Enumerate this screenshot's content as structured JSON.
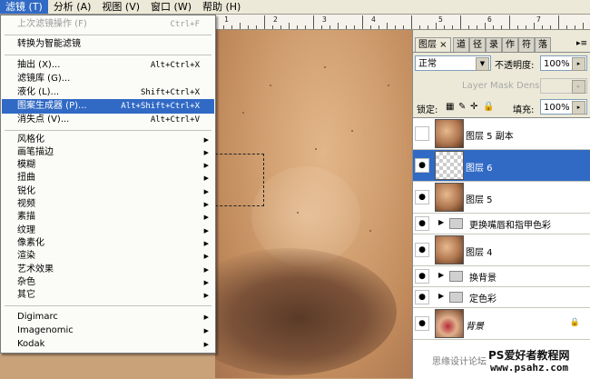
{
  "menubar": {
    "items": [
      {
        "label": "滤镜 (T)"
      },
      {
        "label": "分析 (A)"
      },
      {
        "label": "视图 (V)"
      },
      {
        "label": "窗口 (W)"
      },
      {
        "label": "帮助 (H)"
      }
    ]
  },
  "ruler": {
    "labels": [
      "1",
      "2",
      "3",
      "4",
      "5",
      "6",
      "7"
    ]
  },
  "filter_menu": {
    "last_filter": {
      "label": "上次滤镜操作 (F)",
      "shortcut": "Ctrl+F"
    },
    "smart_filter": {
      "label": "转换为智能滤镜"
    },
    "extract": {
      "label": "抽出 (X)...",
      "shortcut": "Alt+Ctrl+X"
    },
    "gallery": {
      "label": "滤镜库 (G)..."
    },
    "liquify": {
      "label": "液化 (L)...",
      "shortcut": "Shift+Ctrl+X"
    },
    "pattern_maker": {
      "label": "图案生成器 (P)...",
      "shortcut": "Alt+Shift+Ctrl+X"
    },
    "vanishing_point": {
      "label": "消失点 (V)...",
      "shortcut": "Alt+Ctrl+V"
    },
    "groups": [
      {
        "label": "风格化"
      },
      {
        "label": "画笔描边"
      },
      {
        "label": "模糊"
      },
      {
        "label": "扭曲"
      },
      {
        "label": "锐化"
      },
      {
        "label": "视频"
      },
      {
        "label": "素描"
      },
      {
        "label": "纹理"
      },
      {
        "label": "像素化"
      },
      {
        "label": "渲染"
      },
      {
        "label": "艺术效果"
      },
      {
        "label": "杂色"
      },
      {
        "label": "其它"
      }
    ],
    "plugins": [
      {
        "label": "Digimarc"
      },
      {
        "label": "Imagenomic"
      },
      {
        "label": "Kodak"
      }
    ]
  },
  "layers_panel": {
    "tabs": [
      {
        "label": "图层 ×"
      },
      {
        "label": "道"
      },
      {
        "label": "径"
      },
      {
        "label": "录"
      },
      {
        "label": "作"
      },
      {
        "label": "符"
      },
      {
        "label": "落"
      }
    ],
    "blend_mode": "正常",
    "opacity_label": "不透明度:",
    "opacity_value": "100%",
    "mask_density": "Layer Mask Density",
    "lock_label": "锁定:",
    "fill_label": "填充:",
    "fill_value": "100%",
    "layers": [
      {
        "name": "图层 5 副本",
        "visible": false,
        "selected": false
      },
      {
        "name": "图层 6",
        "visible": true,
        "selected": true
      },
      {
        "name": "图层 5",
        "visible": true,
        "selected": false
      },
      {
        "name": "更换嘴唇和指甲色彩",
        "visible": true,
        "type": "group"
      },
      {
        "name": "图层 4",
        "visible": true,
        "selected": false
      },
      {
        "name": "换背景",
        "visible": true,
        "type": "group"
      },
      {
        "name": "定色彩",
        "visible": true,
        "type": "group"
      },
      {
        "name": "背景",
        "visible": true,
        "locked": true
      }
    ]
  },
  "watermark": {
    "text": "思缘设计论坛",
    "brand": "PS爱好者教程网",
    "url": "www.psahz.com"
  }
}
